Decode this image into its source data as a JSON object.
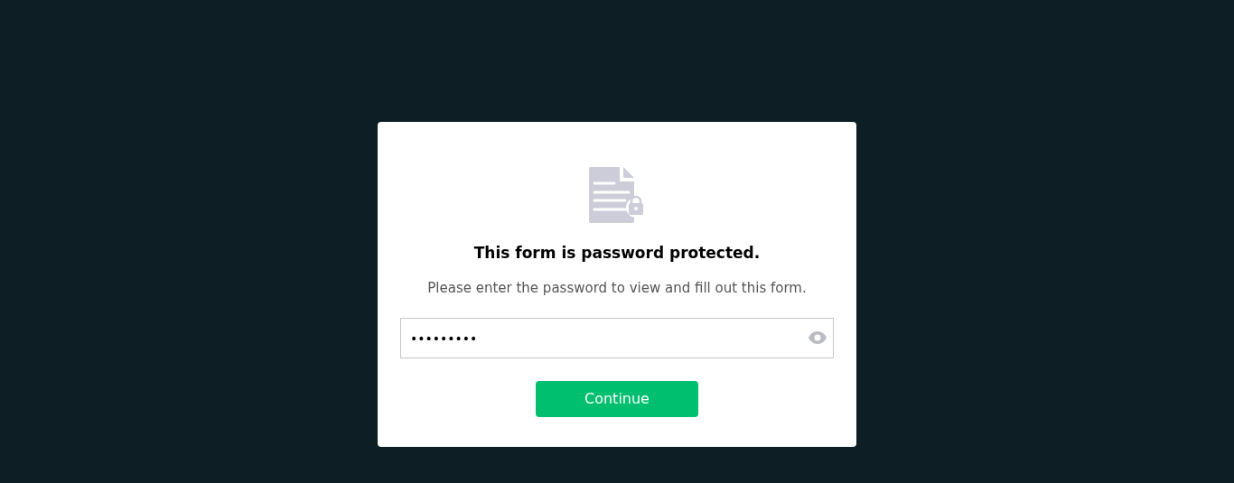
{
  "dialog": {
    "title": "This form is password protected.",
    "message": "Please enter the password to view and fill out this form.",
    "password_field": {
      "value": "•••••••••"
    },
    "button": "Continue"
  }
}
